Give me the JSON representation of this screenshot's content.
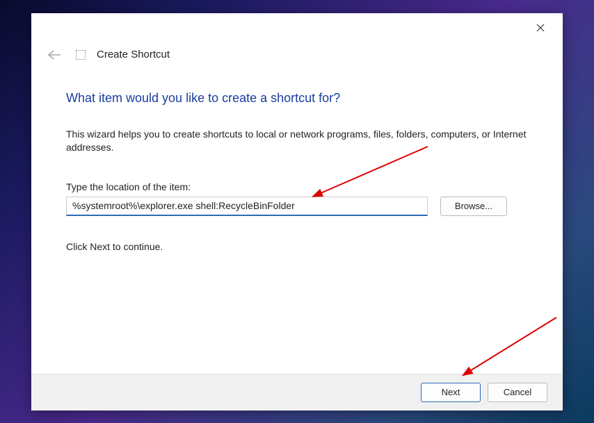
{
  "header": {
    "title": "Create Shortcut"
  },
  "main": {
    "heading": "What item would you like to create a shortcut for?",
    "description": "This wizard helps you to create shortcuts to local or network programs, files, folders, computers, or Internet addresses.",
    "field_label": "Type the location of the item:",
    "location_value": "%systemroot%\\explorer.exe shell:RecycleBinFolder",
    "browse_label": "Browse...",
    "continue_text": "Click Next to continue."
  },
  "footer": {
    "next_label": "Next",
    "cancel_label": "Cancel"
  }
}
